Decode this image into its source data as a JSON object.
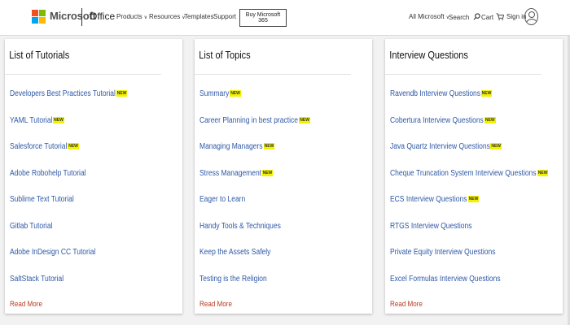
{
  "header": {
    "brand": "Microsoft",
    "office": "Office",
    "nav": [
      {
        "label": "Products",
        "has_menu": true
      },
      {
        "label": "Resources",
        "has_menu": true
      },
      {
        "label": "Templates",
        "has_menu": false
      },
      {
        "label": "Support",
        "has_menu": false
      }
    ],
    "buy_button": "Buy Microsoft 365",
    "all_microsoft": "All Microsoft",
    "search": "Search",
    "cart": "Cart",
    "signin": "Sign in",
    "logo_colors": [
      "#f25022",
      "#7fba00",
      "#00a4ef",
      "#ffb900"
    ]
  },
  "cards": [
    {
      "title": "List of Tutorials",
      "items": [
        {
          "label": "Developers Best Practices Tutorial",
          "badge": "NEW"
        },
        {
          "label": "YAML Tutorial",
          "badge": "NEW"
        },
        {
          "label": "Salesforce Tutorial",
          "badge": "NEW"
        },
        {
          "label": "Adobe Robohelp Tutorial",
          "badge": ""
        },
        {
          "label": "Sublime Text Tutorial",
          "badge": ""
        },
        {
          "label": "Gitlab Tutorial",
          "badge": ""
        },
        {
          "label": "Adobe InDesign CC Tutorial",
          "badge": ""
        },
        {
          "label": "SaltStack Tutorial",
          "badge": ""
        }
      ],
      "read_more": "Read More"
    },
    {
      "title": "List of Topics",
      "items": [
        {
          "label": "Summary",
          "badge": "NEW"
        },
        {
          "label": "Career Planning in best practice",
          "badge": "NEW"
        },
        {
          "label": "Managing Managers",
          "badge": "NEW"
        },
        {
          "label": "Stress Management",
          "badge": "NEW"
        },
        {
          "label": "Eager to Learn",
          "badge": ""
        },
        {
          "label": "Handy Tools & Techniques",
          "badge": ""
        },
        {
          "label": "Keep the Assets Safely",
          "badge": ""
        },
        {
          "label": "Testing is the Religion",
          "badge": ""
        }
      ],
      "read_more": "Read More"
    },
    {
      "title": "Interview Questions",
      "items": [
        {
          "label": "Ravendb Interview Questions",
          "badge": "NEW"
        },
        {
          "label": "Cobertura Interview Questions",
          "badge": "NEW"
        },
        {
          "label": "Java Quartz Interview Questions",
          "badge": "NEW"
        },
        {
          "label": "Cheque Truncation System Interview Questions",
          "badge": "NEW"
        },
        {
          "label": "ECS Interview Questions",
          "badge": "NEW"
        },
        {
          "label": "RTGS Interview Questions",
          "badge": ""
        },
        {
          "label": "Private Equity Interview Questions",
          "badge": ""
        },
        {
          "label": "Excel Formulas Interview Questions",
          "badge": ""
        }
      ],
      "read_more": "Read More"
    }
  ],
  "colors": {
    "link": "#2e58a6",
    "read_more": "#b53a1f",
    "badge": "#f1f100"
  }
}
